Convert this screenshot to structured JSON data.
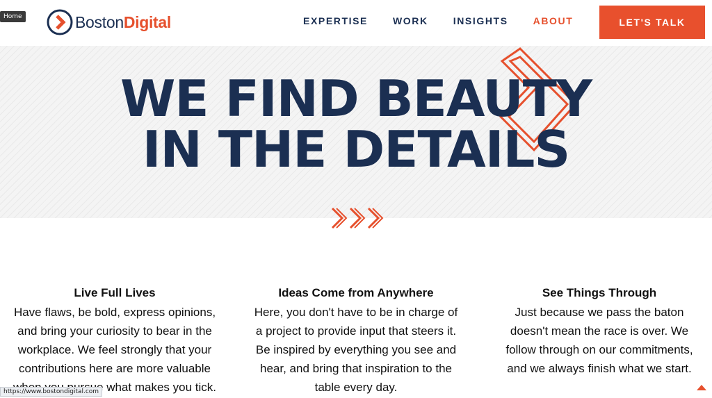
{
  "tooltip": "Home",
  "logo": {
    "word_regular": "Boston",
    "word_bold": "Digital"
  },
  "nav": {
    "items": [
      {
        "label": "EXPERTISE"
      },
      {
        "label": "WORK"
      },
      {
        "label": "INSIGHTS"
      },
      {
        "label": "ABOUT",
        "active": true
      }
    ],
    "cta": "LET'S TALK"
  },
  "hero": {
    "line1": "WE FIND BEAUTY",
    "line2": "IN THE DETAILS"
  },
  "values": [
    {
      "title": "Live Full Lives",
      "body": [
        "Have flaws, be bold, express opinions,",
        "and bring your curiosity to bear in the",
        "workplace. We feel strongly that your",
        "contributions here are more valuable",
        "when you pursue what makes you tick."
      ]
    },
    {
      "title": "Ideas Come from Anywhere",
      "body": [
        "Here, you don't have to be in charge of",
        "a project to provide input that steers it.",
        "Be inspired by everything you see and",
        "hear, and bring that inspiration to the",
        "table every day."
      ]
    },
    {
      "title": "See Things Through",
      "body": [
        "Just because we pass the baton",
        "doesn't mean the race is over. We",
        "follow through on our commitments,",
        "and we always finish what we start."
      ]
    }
  ],
  "status_url": "https://www.bostondigital.com",
  "colors": {
    "navy": "#1b2f52",
    "accent": "#e6502d"
  },
  "icons": {
    "logo": "chevron-circle-logo-icon",
    "scroll": "triple-chevron-icon",
    "back_to_top": "arrow-up-icon"
  }
}
